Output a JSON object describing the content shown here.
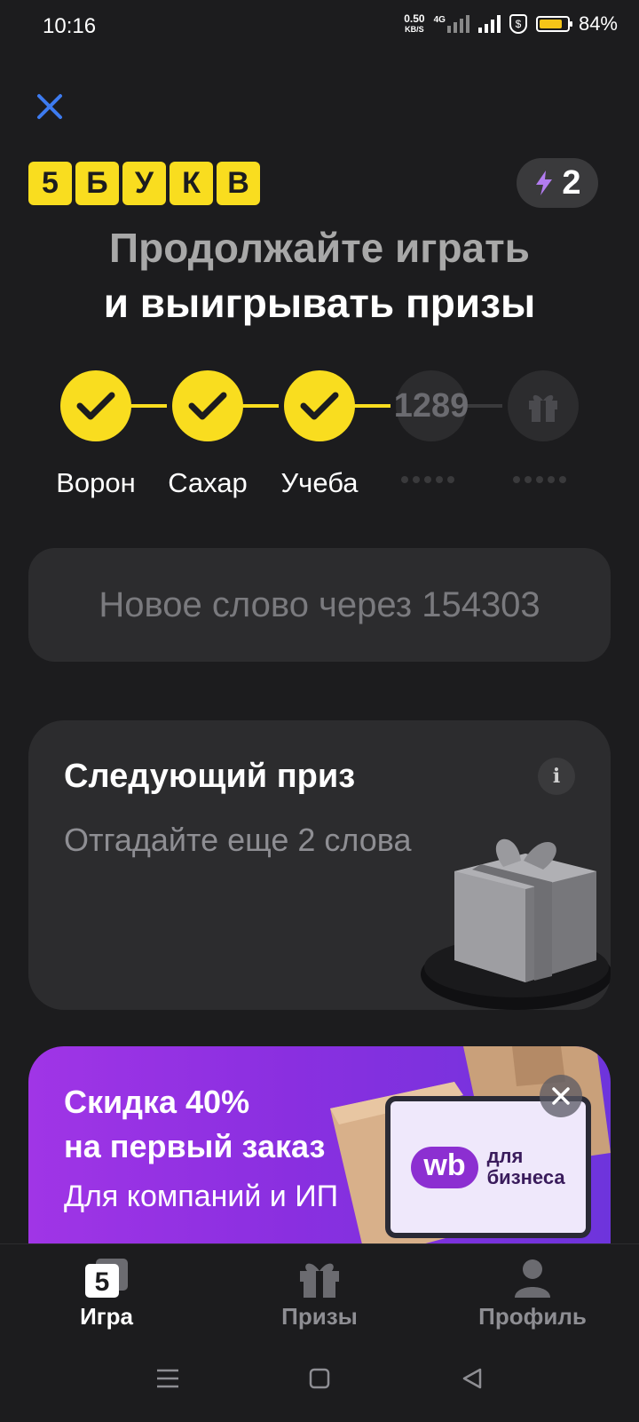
{
  "status_bar": {
    "time": "10:16",
    "net_speed_value": "0.50",
    "net_speed_unit": "KB/S",
    "network_type": "4G",
    "battery": "84%"
  },
  "header": {
    "logo_letters": [
      "5",
      "Б",
      "У",
      "К",
      "В"
    ],
    "energy_count": "2"
  },
  "headline": {
    "line1": "Продолжайте играть",
    "line2": "и выигрывать призы"
  },
  "progress": {
    "steps": [
      {
        "label": "Ворон",
        "state": "done"
      },
      {
        "label": "Сахар",
        "state": "done"
      },
      {
        "label": "Учеба",
        "state": "done"
      },
      {
        "label": "",
        "state": "locked",
        "counter": "1289"
      },
      {
        "label": "",
        "state": "gift"
      }
    ]
  },
  "timer": {
    "text": "Новое слово через 154303"
  },
  "prize_card": {
    "title": "Следующий приз",
    "subtitle": "Отгадайте еще 2 слова"
  },
  "promo": {
    "title_line1": "Скидка 40%",
    "title_line2": "на первый заказ",
    "subtitle": "Для компаний и ИП",
    "brand_badge": "wb",
    "brand_text_line1": "для",
    "brand_text_line2": "бизнеса"
  },
  "bottom_nav": {
    "items": [
      {
        "label": "Игра",
        "active": true
      },
      {
        "label": "Призы",
        "active": false
      },
      {
        "label": "Профиль",
        "active": false
      }
    ]
  },
  "colors": {
    "background": "#1c1c1e",
    "accent_yellow": "#f9dd1f",
    "card": "#2c2c2e",
    "promo_purple": "#8a2fe0",
    "close_blue": "#3d7bf0"
  }
}
